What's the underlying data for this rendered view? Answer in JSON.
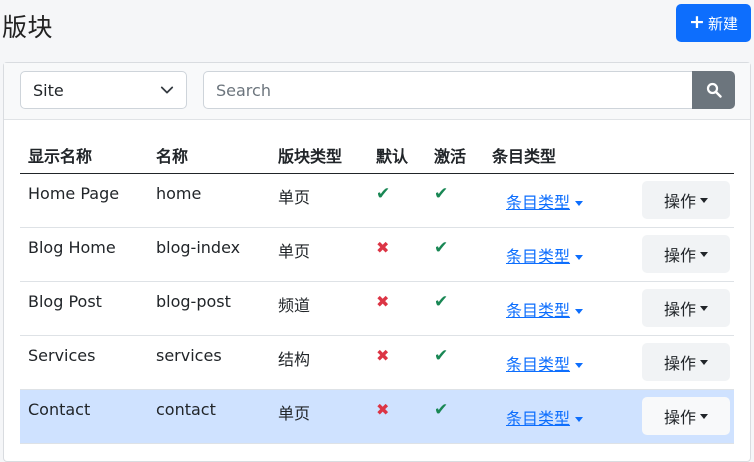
{
  "header": {
    "title": "版块",
    "new_button_label": "新建",
    "new_button_icon": "plus-icon"
  },
  "filters": {
    "site_value": "Site",
    "search_placeholder": "Search",
    "search_value": "",
    "search_icon": "search-icon"
  },
  "table": {
    "columns": [
      "显示名称",
      "名称",
      "版块类型",
      "默认",
      "激活",
      "条目类型"
    ],
    "rows": [
      {
        "display_name": "Home Page",
        "name": "home",
        "type": "单页",
        "default": true,
        "active": true,
        "entry_types_label": "条目类型",
        "actions_label": "操作",
        "selected": false
      },
      {
        "display_name": "Blog Home",
        "name": "blog-index",
        "type": "单页",
        "default": false,
        "active": true,
        "entry_types_label": "条目类型",
        "actions_label": "操作",
        "selected": false
      },
      {
        "display_name": "Blog Post",
        "name": "blog-post",
        "type": "频道",
        "default": false,
        "active": true,
        "entry_types_label": "条目类型",
        "actions_label": "操作",
        "selected": false
      },
      {
        "display_name": "Services",
        "name": "services",
        "type": "结构",
        "default": false,
        "active": true,
        "entry_types_label": "条目类型",
        "actions_label": "操作",
        "selected": false
      },
      {
        "display_name": "Contact",
        "name": "contact",
        "type": "单页",
        "default": false,
        "active": true,
        "entry_types_label": "条目类型",
        "actions_label": "操作",
        "selected": true
      }
    ]
  },
  "colors": {
    "primary": "#0d6efd",
    "check": "#198754",
    "cross": "#dc3545",
    "selected_row": "#cfe2ff",
    "search_button": "#6c757d"
  }
}
